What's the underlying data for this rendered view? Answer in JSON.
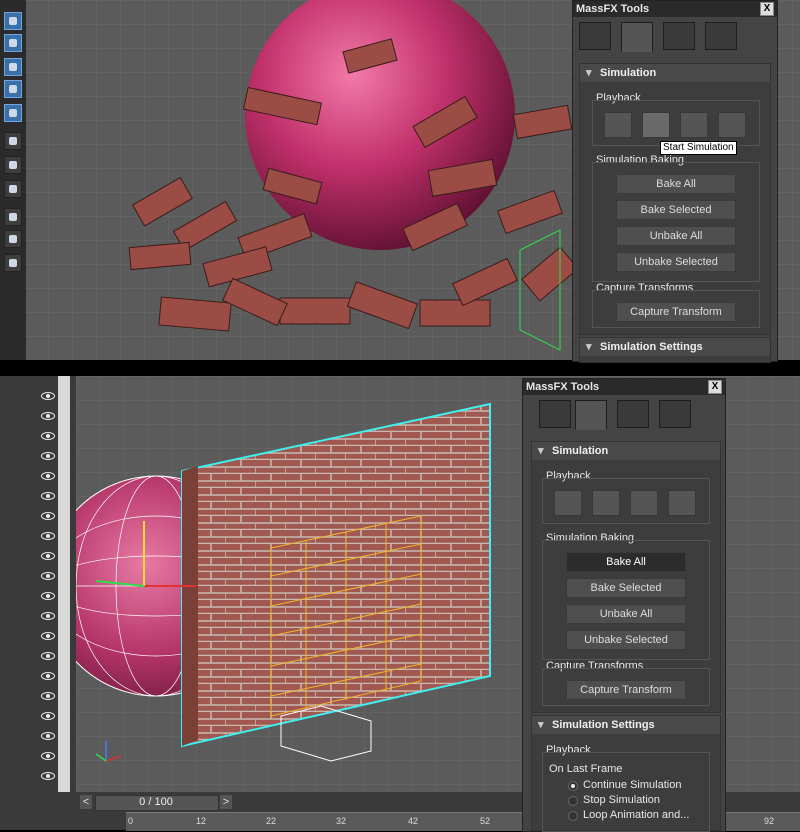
{
  "top": {
    "panel": {
      "title": "MassFX Tools",
      "close_label": "X",
      "rollout_simulation": "Simulation",
      "group_playback": "Playback",
      "tooltip": "Start Simulation",
      "group_baking": "Simulation Baking",
      "buttons_baking": [
        "Bake All",
        "Bake Selected",
        "Unbake All",
        "Unbake Selected"
      ],
      "group_capture": "Capture Transforms",
      "capture_button": "Capture Transform",
      "rollout_settings": "Simulation Settings"
    }
  },
  "bottom": {
    "panel": {
      "title": "MassFX Tools",
      "close_label": "X",
      "rollout_simulation": "Simulation",
      "group_playback": "Playback",
      "group_baking": "Simulation Baking",
      "buttons_baking": [
        "Bake All",
        "Bake Selected",
        "Unbake All",
        "Unbake Selected"
      ],
      "group_capture": "Capture Transforms",
      "capture_button": "Capture Transform",
      "rollout_settings": "Simulation Settings",
      "settings_playback": "Playback",
      "on_last_frame": "On Last Frame",
      "radio_options": [
        "Continue Simulation",
        "Stop Simulation",
        "Loop Animation and..."
      ]
    },
    "timeline": {
      "frame_display": "0 / 100",
      "prev_label": "<",
      "next_label": ">",
      "ticks": [
        "0",
        "12",
        "22",
        "32",
        "42",
        "52",
        "92"
      ]
    }
  },
  "colors": {
    "accent": "#3b6fa8",
    "sphere": "#c0306a",
    "selection_cyan": "#3ff0f0",
    "brick_highlight": "#f2b62a"
  }
}
